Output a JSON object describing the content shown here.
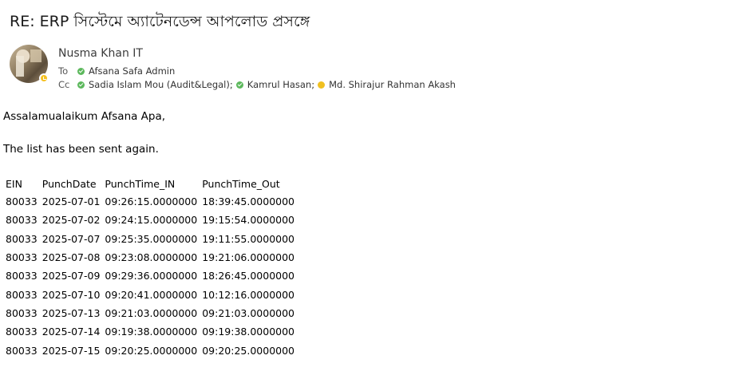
{
  "email": {
    "subject": "RE: ERP সিস্টেমে অ্যাটেনডেন্স আপলোড  প্রসঙ্গে",
    "sender": "Nusma Khan IT",
    "to_label": "To",
    "cc_label": "Cc",
    "to": [
      {
        "name": "Afsana Safa Admin",
        "status": "available",
        "color": "#5cb85c"
      }
    ],
    "cc": [
      {
        "name": "Sadia Islam Mou (Audit&Legal)",
        "status": "available",
        "color": "#5cb85c"
      },
      {
        "name": "Kamrul Hasan",
        "status": "available",
        "color": "#5cb85c"
      },
      {
        "name": "Md. Shirajur Rahman Akash",
        "status": "away",
        "color": "#f0c020"
      }
    ],
    "sender_status": "away",
    "greeting": "Assalamualaikum Afsana Apa,",
    "message": "The list has been sent again.",
    "table": {
      "headers": [
        "EIN",
        "PunchDate",
        "PunchTime_IN",
        "PunchTime_Out"
      ],
      "rows": [
        [
          "80033",
          "2025-07-01",
          "09:26:15.0000000",
          "18:39:45.0000000"
        ],
        [
          "80033",
          "2025-07-02",
          "09:24:15.0000000",
          "19:15:54.0000000"
        ],
        [
          "80033",
          "2025-07-07",
          "09:25:35.0000000",
          "19:11:55.0000000"
        ],
        [
          "80033",
          "2025-07-08",
          "09:23:08.0000000",
          "19:21:06.0000000"
        ],
        [
          "80033",
          "2025-07-09",
          "09:29:36.0000000",
          "18:26:45.0000000"
        ],
        [
          "80033",
          "2025-07-10",
          "09:20:41.0000000",
          "10:12:16.0000000"
        ],
        [
          "80033",
          "2025-07-13",
          "09:21:03.0000000",
          "09:21:03.0000000"
        ],
        [
          "80033",
          "2025-07-14",
          "09:19:38.0000000",
          "09:19:38.0000000"
        ],
        [
          "80033",
          "2025-07-15",
          "09:20:25.0000000",
          "09:20:25.0000000"
        ]
      ]
    }
  }
}
